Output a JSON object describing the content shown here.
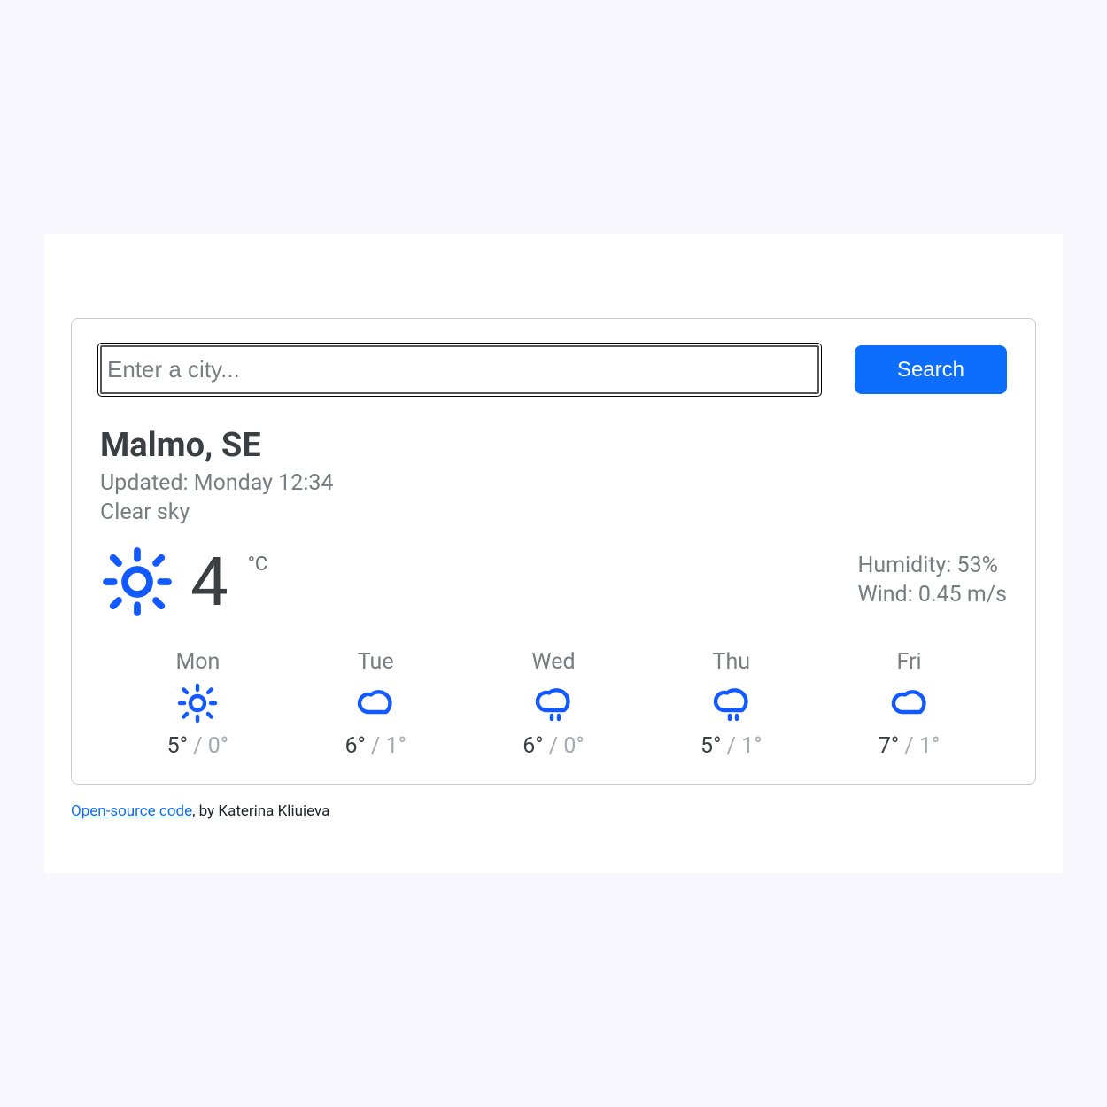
{
  "search": {
    "placeholder": "Enter a city...",
    "button_label": "Search"
  },
  "location": {
    "title": "Malmo, SE",
    "updated": "Updated: Monday 12:34",
    "description": "Clear sky"
  },
  "current": {
    "icon": "sun",
    "temp": "4",
    "unit": "°C",
    "humidity": "Humidity: 53%",
    "wind": "Wind: 0.45 m/s"
  },
  "forecast": [
    {
      "day": "Mon",
      "icon": "sun",
      "hi": "5°",
      "lo": "0°"
    },
    {
      "day": "Tue",
      "icon": "cloud",
      "hi": "6°",
      "lo": "1°"
    },
    {
      "day": "Wed",
      "icon": "drizzle",
      "hi": "6°",
      "lo": "0°"
    },
    {
      "day": "Thu",
      "icon": "drizzle",
      "hi": "5°",
      "lo": "1°"
    },
    {
      "day": "Fri",
      "icon": "cloud",
      "hi": "7°",
      "lo": "1°"
    }
  ],
  "footer": {
    "link_text": "Open-source code",
    "tail": ", by Katerina Kliuieva"
  }
}
